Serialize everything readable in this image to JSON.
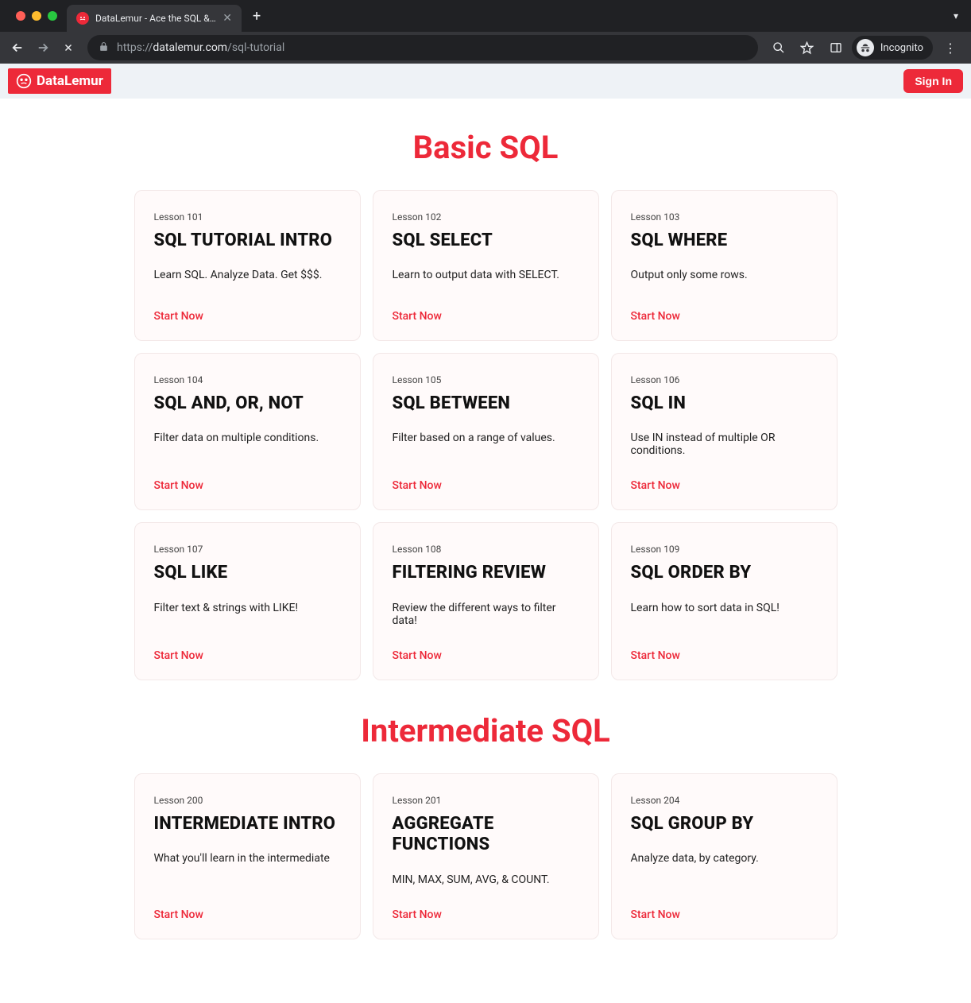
{
  "browser": {
    "tab_title": "DataLemur - Ace the SQL & Da",
    "url_protocol": "https://",
    "url_domain": "datalemur.com",
    "url_path": "/sql-tutorial",
    "incognito_label": "Incognito"
  },
  "header": {
    "logo_text": "DataLemur",
    "signin_label": "Sign In"
  },
  "sections": [
    {
      "title": "Basic SQL",
      "cards": [
        {
          "lesson": "Lesson 101",
          "title": "SQL TUTORIAL INTRO",
          "desc": "Learn SQL. Analyze Data. Get $$$.",
          "cta": "Start Now"
        },
        {
          "lesson": "Lesson 102",
          "title": "SQL SELECT",
          "desc": "Learn to output data with SELECT.",
          "cta": "Start Now"
        },
        {
          "lesson": "Lesson 103",
          "title": "SQL WHERE",
          "desc": "Output only some rows.",
          "cta": "Start Now"
        },
        {
          "lesson": "Lesson 104",
          "title": "SQL AND, OR, NOT",
          "desc": "Filter data on multiple conditions.",
          "cta": "Start Now"
        },
        {
          "lesson": "Lesson 105",
          "title": "SQL BETWEEN",
          "desc": "Filter based on a range of values.",
          "cta": "Start Now"
        },
        {
          "lesson": "Lesson 106",
          "title": "SQL IN",
          "desc": "Use IN instead of multiple OR conditions.",
          "cta": "Start Now"
        },
        {
          "lesson": "Lesson 107",
          "title": "SQL LIKE",
          "desc": "Filter text & strings with LIKE!",
          "cta": "Start Now"
        },
        {
          "lesson": "Lesson 108",
          "title": "FILTERING REVIEW",
          "desc": "Review the different ways to filter data!",
          "cta": "Start Now"
        },
        {
          "lesson": "Lesson 109",
          "title": "SQL ORDER BY",
          "desc": "Learn how to sort data in SQL!",
          "cta": "Start Now"
        }
      ]
    },
    {
      "title": "Intermediate SQL",
      "cards": [
        {
          "lesson": "Lesson 200",
          "title": "INTERMEDIATE INTRO",
          "desc": "What you'll learn in the intermediate",
          "cta": "Start Now"
        },
        {
          "lesson": "Lesson 201",
          "title": "AGGREGATE FUNCTIONS",
          "desc": "MIN, MAX, SUM, AVG, & COUNT.",
          "cta": "Start Now"
        },
        {
          "lesson": "Lesson 204",
          "title": "SQL GROUP BY",
          "desc": "Analyze data, by category.",
          "cta": "Start Now"
        }
      ]
    }
  ]
}
